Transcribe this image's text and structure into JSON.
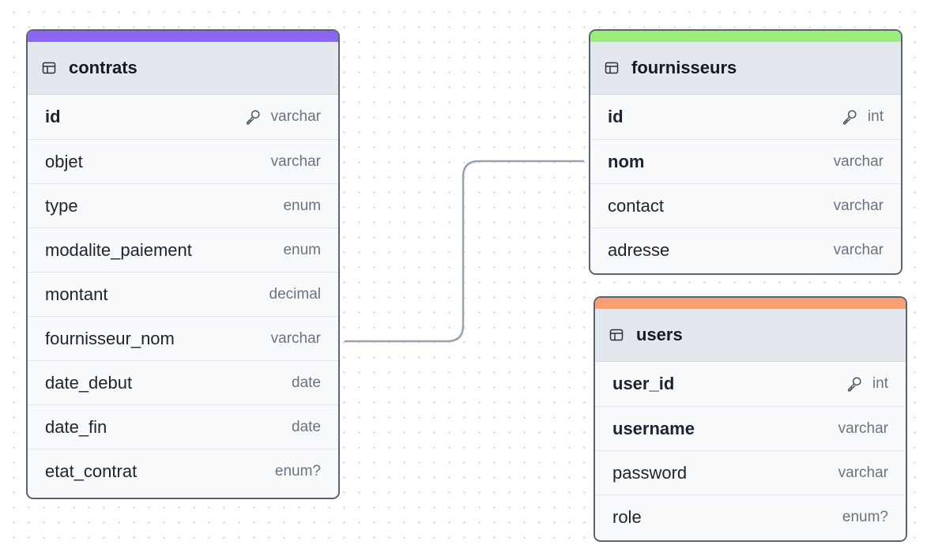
{
  "colors": {
    "contrats_accent": "#8b67f0",
    "fournisseurs_accent": "#9fec7e",
    "users_accent": "#f7a074",
    "edge": "#99a3b0"
  },
  "icons": {
    "table": "table-icon",
    "primary_key": "key-icon"
  },
  "tables": {
    "contrats": {
      "name": "contrats",
      "columns": [
        {
          "name": "id",
          "type": "varchar",
          "pk": true
        },
        {
          "name": "objet",
          "type": "varchar"
        },
        {
          "name": "type",
          "type": "enum"
        },
        {
          "name": "modalite_paiement",
          "type": "enum"
        },
        {
          "name": "montant",
          "type": "decimal"
        },
        {
          "name": "fournisseur_nom",
          "type": "varchar"
        },
        {
          "name": "date_debut",
          "type": "date"
        },
        {
          "name": "date_fin",
          "type": "date"
        },
        {
          "name": "etat_contrat",
          "type": "enum?"
        }
      ]
    },
    "fournisseurs": {
      "name": "fournisseurs",
      "columns": [
        {
          "name": "id",
          "type": "int",
          "pk": true
        },
        {
          "name": "nom",
          "type": "varchar",
          "bold": true
        },
        {
          "name": "contact",
          "type": "varchar"
        },
        {
          "name": "adresse",
          "type": "varchar"
        }
      ]
    },
    "users": {
      "name": "users",
      "columns": [
        {
          "name": "user_id",
          "type": "int",
          "pk": true
        },
        {
          "name": "username",
          "type": "varchar",
          "bold": true
        },
        {
          "name": "password",
          "type": "varchar"
        },
        {
          "name": "role",
          "type": "enum?"
        }
      ]
    }
  },
  "relationships": [
    {
      "from": "contrats.fournisseur_nom",
      "to": "fournisseurs.nom"
    }
  ]
}
